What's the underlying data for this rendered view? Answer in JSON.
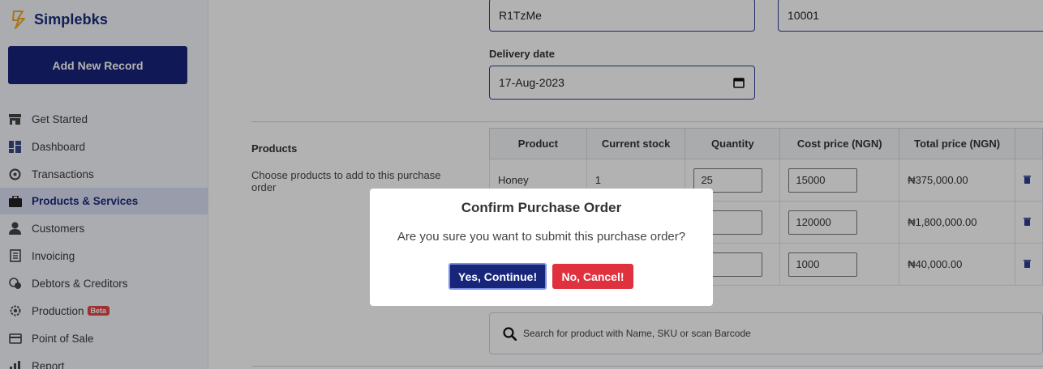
{
  "app": {
    "name": "Simplebks"
  },
  "sidebar": {
    "add_button": "Add New Record",
    "items": [
      {
        "label": "Get Started",
        "icon": "store-icon",
        "active": false
      },
      {
        "label": "Dashboard",
        "icon": "dashboard-icon",
        "active": false
      },
      {
        "label": "Transactions",
        "icon": "transactions-icon",
        "active": false
      },
      {
        "label": "Products & Services",
        "icon": "briefcase-icon",
        "active": true
      },
      {
        "label": "Customers",
        "icon": "user-icon",
        "active": false
      },
      {
        "label": "Invoicing",
        "icon": "invoice-icon",
        "active": false
      },
      {
        "label": "Debtors & Creditors",
        "icon": "debtors-icon",
        "active": false
      },
      {
        "label": "Production",
        "icon": "gear-icon",
        "active": false,
        "badge": "Beta"
      },
      {
        "label": "Point of Sale",
        "icon": "card-icon",
        "active": false
      },
      {
        "label": "Report",
        "icon": "report-icon",
        "active": false
      }
    ]
  },
  "form": {
    "field1_value": "R1TzMe",
    "field2_value": "10001",
    "delivery_label": "Delivery date",
    "delivery_value": "17-Aug-2023"
  },
  "products": {
    "title": "Products",
    "description": "Choose products to add to this purchase order",
    "headers": [
      "Product",
      "Current stock",
      "Quantity",
      "Cost price (NGN)",
      "Total price (NGN)"
    ],
    "rows": [
      {
        "product": "Honey",
        "stock": "1",
        "quantity": "25",
        "cost": "15000",
        "total": "₦375,000.00"
      },
      {
        "product": "",
        "stock": "",
        "quantity": "",
        "cost": "120000",
        "total": "₦1,800,000.00"
      },
      {
        "product": "",
        "stock": "",
        "quantity": "",
        "cost": "1000",
        "total": "₦40,000.00"
      }
    ],
    "search_placeholder": "Search for product with Name, SKU or scan Barcode"
  },
  "modal": {
    "title": "Confirm Purchase Order",
    "text": "Are you sure you want to submit this purchase order?",
    "yes": "Yes, Continue!",
    "no": "No, Cancel!"
  },
  "colors": {
    "primary": "#17257a",
    "danger": "#e0313e",
    "accent": "#f5a623"
  }
}
